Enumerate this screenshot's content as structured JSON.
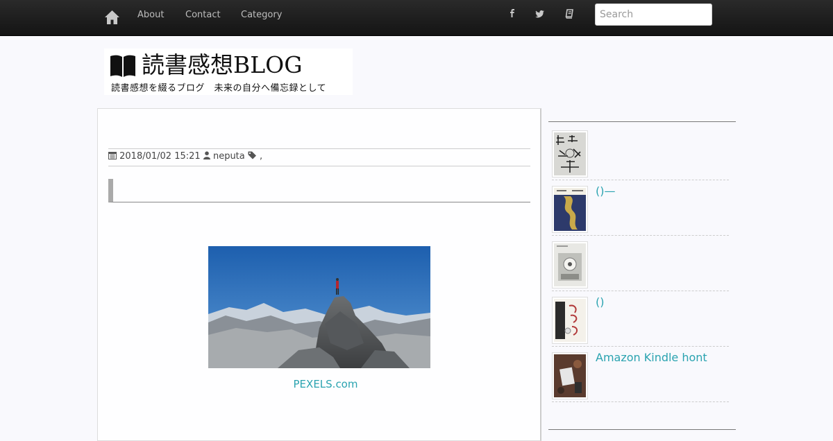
{
  "nav": {
    "home_icon": "home-icon",
    "links": [
      {
        "label": "About"
      },
      {
        "label": "Contact"
      },
      {
        "label": "Category"
      }
    ],
    "social_icons": [
      "facebook-icon",
      "twitter-icon",
      "book-icon"
    ],
    "search_placeholder": "Search"
  },
  "logo": {
    "title": "読書感想BLOG",
    "tagline": "読書感想を綴るブログ　未来の自分へ備忘録として"
  },
  "post": {
    "date": "2018/01/02 15:21",
    "author": "neputa",
    "tags_separator": ",",
    "image_caption": "PEXELS.com"
  },
  "sidebar": {
    "items": [
      {
        "title": ""
      },
      {
        "title": "()—"
      },
      {
        "title": ""
      },
      {
        "title": "()"
      },
      {
        "title": "Amazon Kindle  hont"
      }
    ]
  },
  "colors": {
    "accent": "#2aa3b0",
    "navbar": "#1c1c1c",
    "background": "#f9f9fd"
  }
}
